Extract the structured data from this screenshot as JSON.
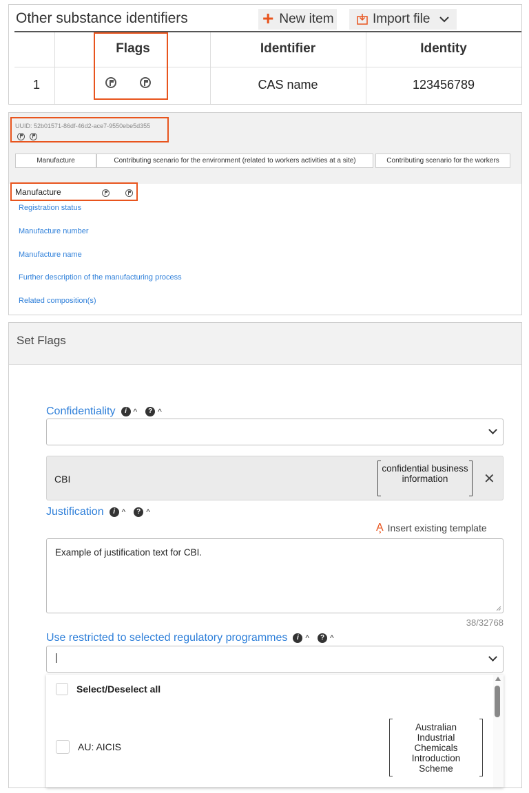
{
  "substances": {
    "title": "Other substance identifiers",
    "new_item_label": "New item",
    "import_label": "Import file",
    "columns": [
      "",
      "Flags",
      "Identifier",
      "Identity"
    ],
    "rows": [
      {
        "index": "1",
        "identifier": "CAS name",
        "identity": "123456789"
      }
    ]
  },
  "detail": {
    "uuid": "UUID: 52b01571-86df-46d2-ace7-9550ebe5d355",
    "tabs": [
      "Manufacture",
      "Contributing scenario for the environment (related to workers activities at a site)",
      "Contributing scenario for the workers"
    ],
    "section_title": "Manufacture",
    "links": [
      "Registration status",
      "Manufacture number",
      "Manufacture name",
      "Further description of the manufacturing process",
      "Related composition(s)"
    ]
  },
  "set_flags": {
    "title": "Set Flags",
    "confidentiality_label": "Confidentiality",
    "confidentiality_value": "",
    "cbi_code": "CBI",
    "cbi_description": "confidential business information",
    "justification_label": "Justification",
    "insert_template_label": "Insert existing template",
    "justification_text": "Example of justification text for CBI.",
    "char_count": "38/32768",
    "programmes_label": "Use restricted to selected regulatory programmes",
    "programmes_value": "|",
    "select_all_label": "Select/Deselect all",
    "options": [
      {
        "code": "AU: AICIS",
        "description": "Australian Industrial Chemicals Introduction Scheme"
      }
    ]
  },
  "colors": {
    "accent": "#e8541d",
    "link": "#2e7fd9"
  }
}
